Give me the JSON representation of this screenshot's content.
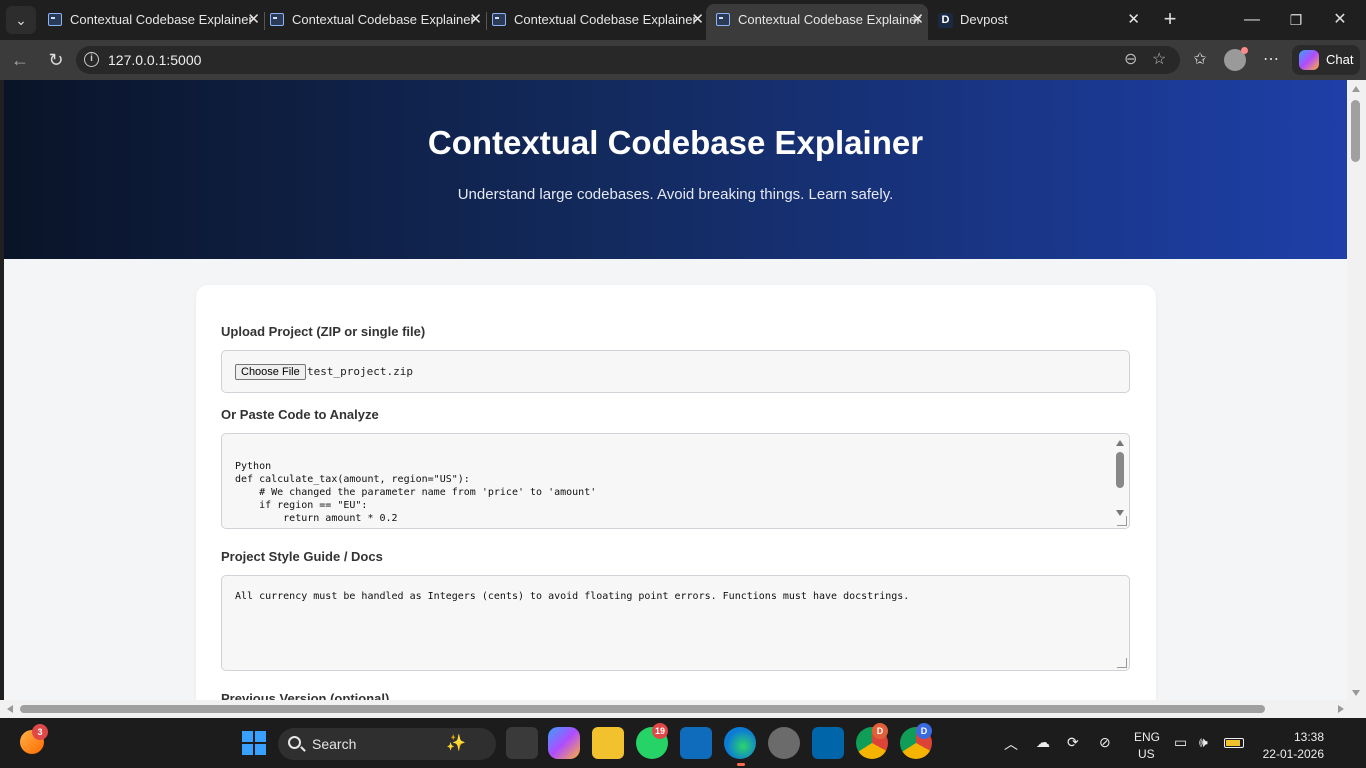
{
  "browser": {
    "tabs": [
      {
        "title": "Contextual Codebase Explainer",
        "active": false
      },
      {
        "title": "Contextual Codebase Explainer",
        "active": false
      },
      {
        "title": "Contextual Codebase Explainer",
        "active": false
      },
      {
        "title": "Contextual Codebase Explainer",
        "active": true
      },
      {
        "title": "Devpost",
        "active": false
      }
    ],
    "devpost_favicon_letter": "D",
    "url": "127.0.0.1:5000",
    "chat_label": "Chat"
  },
  "hero": {
    "title": "Contextual Codebase Explainer",
    "subtitle": "Understand large codebases. Avoid breaking things. Learn safely."
  },
  "form": {
    "upload_label": "Upload Project (ZIP or single file)",
    "choose_file_label": "Choose File",
    "file_name": "test_project.zip",
    "paste_label": "Or Paste Code to Analyze",
    "code_lines": [
      "Python",
      "def calculate_tax(amount, region=\"US\"):",
      "    # We changed the parameter name from 'price' to 'amount'",
      "    if region == \"EU\":",
      "        return amount * 0.2"
    ],
    "style_label": "Project Style Guide / Docs",
    "style_text": "All currency must be handled as Integers (cents) to avoid floating point errors. Functions must have docstrings.",
    "previous_label": "Previous Version (optional)"
  },
  "taskbar": {
    "notification_count": "3",
    "search_placeholder": "Search",
    "whatsapp_badge": "19",
    "chrome_badge": "D",
    "chrome2_badge": "D",
    "lang_top": "ENG",
    "lang_bottom": "US",
    "time": "13:38",
    "date": "22-01-2026"
  },
  "colors": {
    "hero_start": "#0a1428",
    "hero_end": "#1e3fa8"
  }
}
